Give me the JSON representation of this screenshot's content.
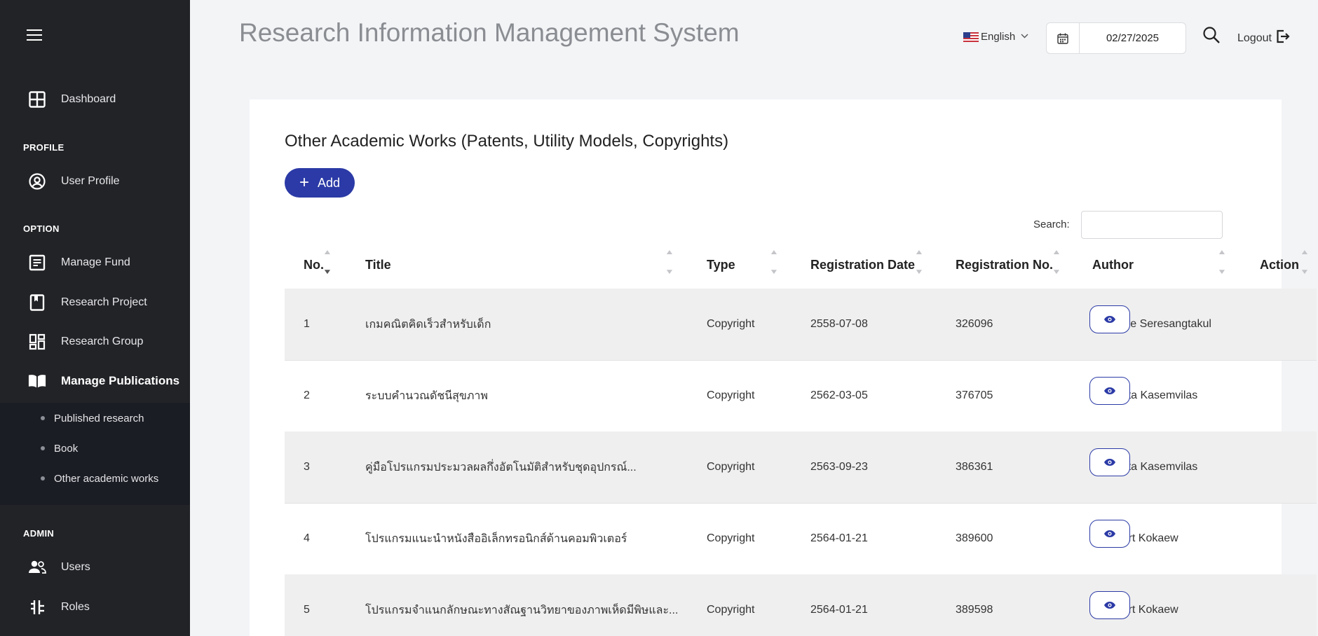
{
  "app_title": "Research Information Management System",
  "header": {
    "language": "English",
    "date": "02/27/2025",
    "logout_label": "Logout"
  },
  "sidebar": {
    "dashboard": "Dashboard",
    "sections": {
      "profile": "PROFILE",
      "option": "OPTION",
      "admin": "ADMIN"
    },
    "user_profile": "User Profile",
    "manage_fund": "Manage Fund",
    "research_project": "Research Project",
    "research_group": "Research Group",
    "manage_publications": "Manage Publications",
    "publications_sub": [
      "Published research",
      "Book",
      "Other academic works"
    ],
    "users": "Users",
    "roles": "Roles"
  },
  "page": {
    "title": "Other Academic Works (Patents, Utility Models, Copyrights)",
    "add_label": "Add",
    "search_label": "Search:",
    "search_value": ""
  },
  "table": {
    "headers": [
      "No.",
      "Title",
      "Type",
      "Registration Date",
      "Registration No.",
      "Author",
      "Action"
    ],
    "rows": [
      {
        "no": "1",
        "title": "เกมคณิตคิดเร็วสำหรับเด็ก",
        "type": "Copyright",
        "date": "2558-07-08",
        "reg_no": "326096",
        "author": "Pusadee Seresangtakul"
      },
      {
        "no": "2",
        "title": "ระบบคำนวณดัชนีสุขภาพ",
        "type": "Copyright",
        "date": "2562-03-05",
        "reg_no": "376705",
        "author": "Sumonta Kasemvilas"
      },
      {
        "no": "3",
        "title": "คู่มือโปรแกรมประมวลผลกึ่งอัตโนมัติสำหรับชุดอุปกรณ์...",
        "type": "Copyright",
        "date": "2563-09-23",
        "reg_no": "386361",
        "author": "Sumonta Kasemvilas"
      },
      {
        "no": "4",
        "title": "โปรแกรมแนะนำหนังสืออิเล็กทรอนิกส์ด้านคอมพิวเตอร์",
        "type": "Copyright",
        "date": "2564-01-21",
        "reg_no": "389600",
        "author": "Urachart Kokaew"
      },
      {
        "no": "5",
        "title": "โปรแกรมจำแนกลักษณะทางสัณฐานวิทยาของภาพเห็ดมีพิษและ...",
        "type": "Copyright",
        "date": "2564-01-21",
        "reg_no": "389598",
        "author": "Urachart Kokaew"
      }
    ]
  },
  "colors": {
    "sidebar_bg": "#222327",
    "submenu_bg": "#1b1d24",
    "accent": "#2b3aa6",
    "page_bg": "#f3f4f6"
  }
}
